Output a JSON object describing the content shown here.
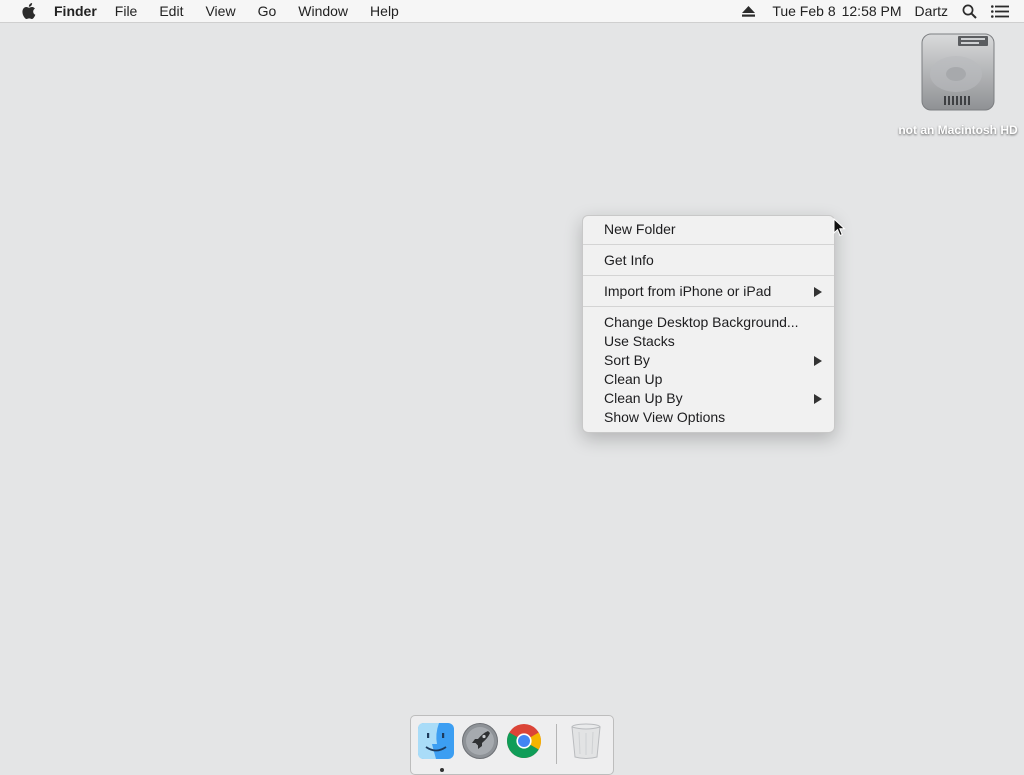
{
  "menubar": {
    "app_name": "Finder",
    "menus": [
      "File",
      "Edit",
      "View",
      "Go",
      "Window",
      "Help"
    ],
    "date": "Tue Feb 8",
    "time": "12:58 PM",
    "user": "Dartz",
    "icons": [
      "apple-icon",
      "eject-icon",
      "spotlight-search-icon",
      "notification-center-icon"
    ]
  },
  "desktop": {
    "disk_label": "not an Macintosh HD"
  },
  "context_menu": {
    "groups": [
      [
        {
          "label": "New Folder",
          "submenu": false
        }
      ],
      [
        {
          "label": "Get Info",
          "submenu": false
        }
      ],
      [
        {
          "label": "Import from iPhone or iPad",
          "submenu": true
        }
      ],
      [
        {
          "label": "Change Desktop Background...",
          "submenu": false
        },
        {
          "label": "Use Stacks",
          "submenu": false
        },
        {
          "label": "Sort By",
          "submenu": true
        },
        {
          "label": "Clean Up",
          "submenu": false
        },
        {
          "label": "Clean Up By",
          "submenu": true
        },
        {
          "label": "Show View Options",
          "submenu": false
        }
      ]
    ]
  },
  "dock": {
    "apps": [
      "Finder",
      "Launchpad",
      "Google Chrome",
      "Trash"
    ],
    "running": [
      "Finder"
    ]
  }
}
